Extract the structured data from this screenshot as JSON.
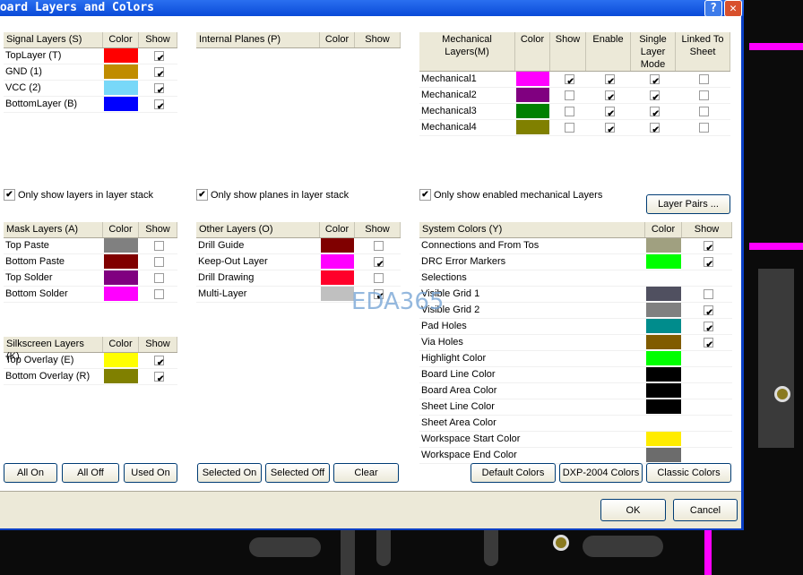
{
  "title": "Board Layers and Colors",
  "title_buttons": {
    "help": "?",
    "close": "✕"
  },
  "signal": {
    "headers": [
      "Signal Layers (S)",
      "Color",
      "Show"
    ],
    "rows": [
      {
        "name": "TopLayer (T)",
        "color": "#ff0000",
        "show": true
      },
      {
        "name": "GND (1)",
        "color": "#c08c00",
        "show": true
      },
      {
        "name": "VCC (2)",
        "color": "#78d8f8",
        "show": true
      },
      {
        "name": "BottomLayer (B)",
        "color": "#0000ff",
        "show": true
      }
    ]
  },
  "planes": {
    "headers": [
      "Internal Planes (P)",
      "Color",
      "Show"
    ],
    "rows": []
  },
  "mech": {
    "headers": [
      "Mechanical Layers(M)",
      "Color",
      "Show",
      "Enable",
      "Single Layer Mode",
      "Linked To Sheet"
    ],
    "rows": [
      {
        "name": "Mechanical1",
        "color": "#ff00ff",
        "checks": [
          true,
          true,
          true,
          false
        ]
      },
      {
        "name": "Mechanical2",
        "color": "#800080",
        "checks": [
          false,
          true,
          true,
          false
        ]
      },
      {
        "name": "Mechanical3",
        "color": "#008000",
        "checks": [
          false,
          true,
          true,
          false
        ]
      },
      {
        "name": "Mechanical4",
        "color": "#808000",
        "checks": [
          false,
          true,
          true,
          false
        ]
      }
    ]
  },
  "options": {
    "only_layers": "Only show layers in layer stack",
    "only_planes": "Only show planes in layer stack",
    "only_mech": "Only show enabled mechanical Layers",
    "layer_pairs": "Layer Pairs ..."
  },
  "mask": {
    "headers": [
      "Mask Layers (A)",
      "Color",
      "Show"
    ],
    "rows": [
      {
        "name": "Top Paste",
        "color": "#808080",
        "show": false
      },
      {
        "name": "Bottom Paste",
        "color": "#800000",
        "show": false
      },
      {
        "name": "Top Solder",
        "color": "#800080",
        "show": false
      },
      {
        "name": "Bottom Solder",
        "color": "#ff00ff",
        "show": false
      }
    ]
  },
  "other": {
    "headers": [
      "Other Layers (O)",
      "Color",
      "Show"
    ],
    "rows": [
      {
        "name": "Drill Guide",
        "color": "#800000",
        "show": false
      },
      {
        "name": "Keep-Out Layer",
        "color": "#ff00ff",
        "show": true
      },
      {
        "name": "Drill Drawing",
        "color": "#ff002a",
        "show": false
      },
      {
        "name": "Multi-Layer",
        "color": "#c0c0c0",
        "show": true
      }
    ]
  },
  "silk": {
    "headers": [
      "Silkscreen Layers (K)",
      "Color",
      "Show"
    ],
    "rows": [
      {
        "name": "Top Overlay (E)",
        "color": "#ffff00",
        "show": true
      },
      {
        "name": "Bottom Overlay (R)",
        "color": "#808000",
        "show": true
      }
    ]
  },
  "system": {
    "headers": [
      "System Colors (Y)",
      "Color",
      "Show"
    ],
    "rows": [
      {
        "name": "Connections and From Tos",
        "color": "#a0a080",
        "show": true
      },
      {
        "name": "DRC Error Markers",
        "color": "#00ff00",
        "show": true
      },
      {
        "name": "Selections",
        "color": "#ffffff",
        "show": null
      },
      {
        "name": "Visible Grid 1",
        "color": "#505060",
        "show": false
      },
      {
        "name": "Visible Grid 2",
        "color": "#808080",
        "show": true
      },
      {
        "name": "Pad Holes",
        "color": "#008c8c",
        "show": true
      },
      {
        "name": "Via Holes",
        "color": "#805c00",
        "show": true
      },
      {
        "name": "Highlight Color",
        "color": "#00ff00",
        "show": null
      },
      {
        "name": "Board Line Color",
        "color": "#000000",
        "show": null
      },
      {
        "name": "Board Area Color",
        "color": "#000000",
        "show": null
      },
      {
        "name": "Sheet Line Color",
        "color": "#000000",
        "show": null
      },
      {
        "name": "Sheet Area Color",
        "color": "#ffffff",
        "show": null
      },
      {
        "name": "Workspace Start Color",
        "color": "#ffec00",
        "show": null
      },
      {
        "name": "Workspace End Color",
        "color": "#6c6c6c",
        "show": null
      }
    ]
  },
  "buttons": {
    "all_on": "All On",
    "all_off": "All Off",
    "used_on": "Used On",
    "selected_on": "Selected On",
    "selected_off": "Selected Off",
    "clear": "Clear",
    "default_colors": "Default Colors",
    "dxp_colors": "DXP-2004 Colors",
    "classic_colors": "Classic Colors",
    "ok": "OK",
    "cancel": "Cancel"
  },
  "watermark": "EDA365"
}
